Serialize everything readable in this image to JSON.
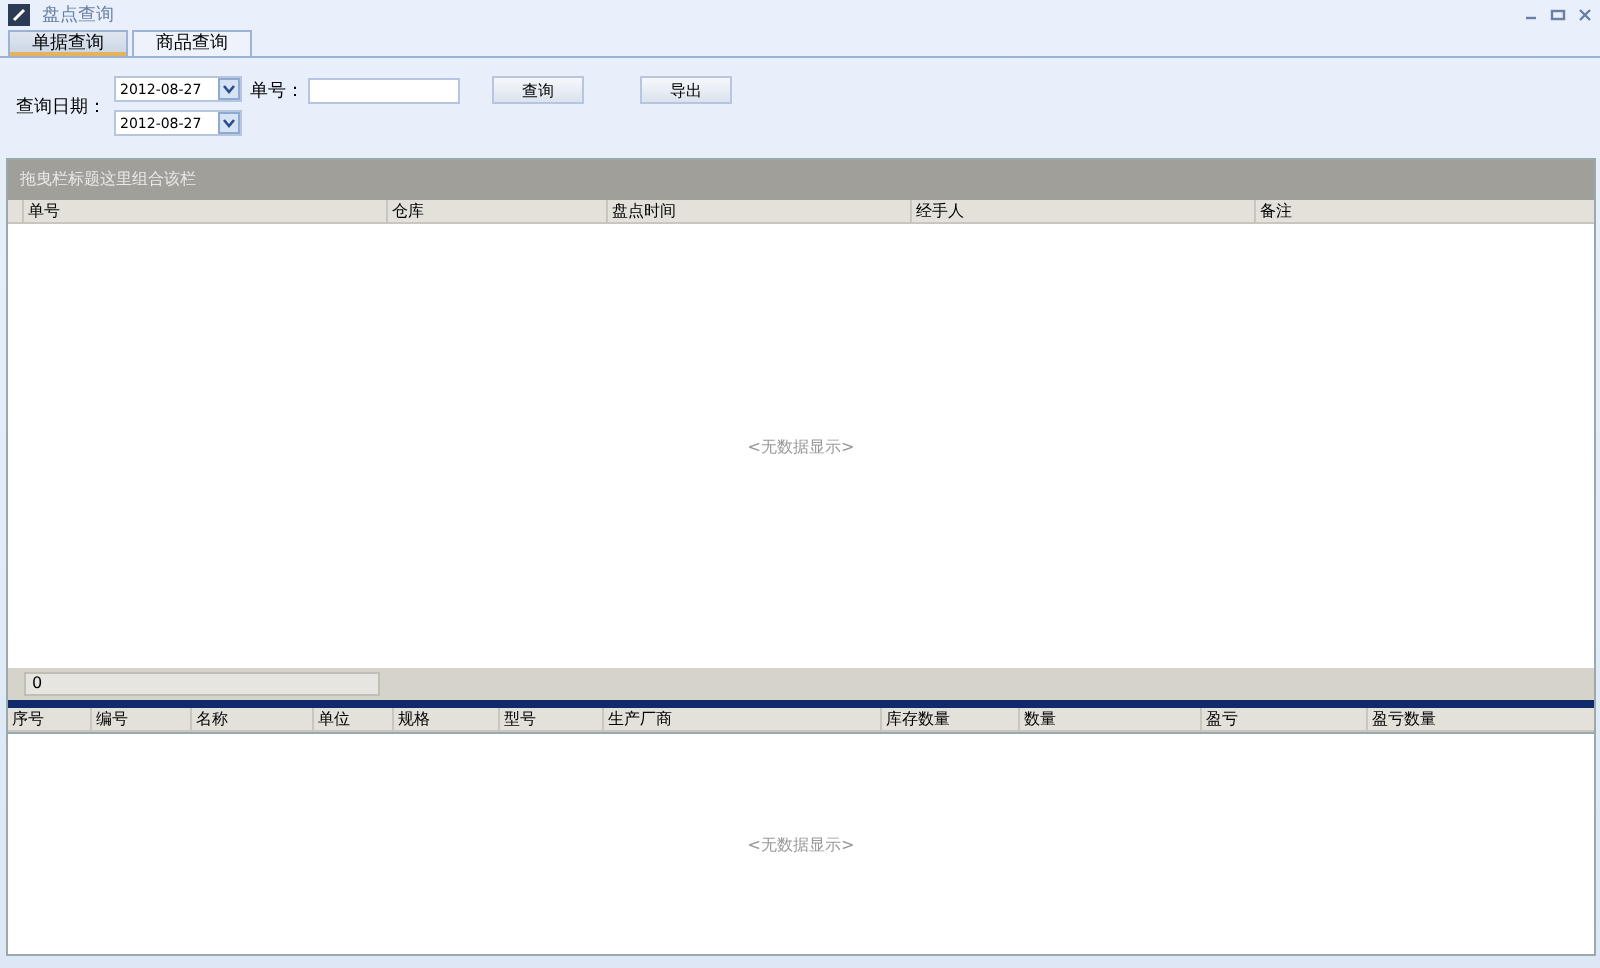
{
  "window": {
    "title": "盘点查询"
  },
  "tabs": [
    {
      "label": "单据查询",
      "selected": true
    },
    {
      "label": "商品查询",
      "selected": false
    }
  ],
  "filter": {
    "date_label": "查询日期：",
    "date_from": "2012-08-27",
    "date_to": "2012-08-27",
    "number_label": "单号：",
    "buttons": [
      "查询",
      "导出"
    ]
  },
  "upper_grid": {
    "group_panel": "拖曳栏标题这里组合该栏",
    "columns": [
      {
        "label": "单号"
      },
      {
        "label": "仓库"
      },
      {
        "label": "盘点时间"
      },
      {
        "label": "经手人"
      },
      {
        "label": "备注"
      }
    ],
    "empty_text": "<无数据显示>",
    "footer_value": "0"
  },
  "lower_grid": {
    "columns": [
      {
        "label": "序号"
      },
      {
        "label": "编号"
      },
      {
        "label": "名称"
      },
      {
        "label": "单位"
      },
      {
        "label": "规格"
      },
      {
        "label": "型号"
      },
      {
        "label": "生产厂商"
      },
      {
        "label": "库存数量"
      },
      {
        "label": "数量"
      },
      {
        "label": "盈亏"
      },
      {
        "label": "盈亏数量"
      }
    ],
    "empty_text": "<无数据显示>"
  }
}
